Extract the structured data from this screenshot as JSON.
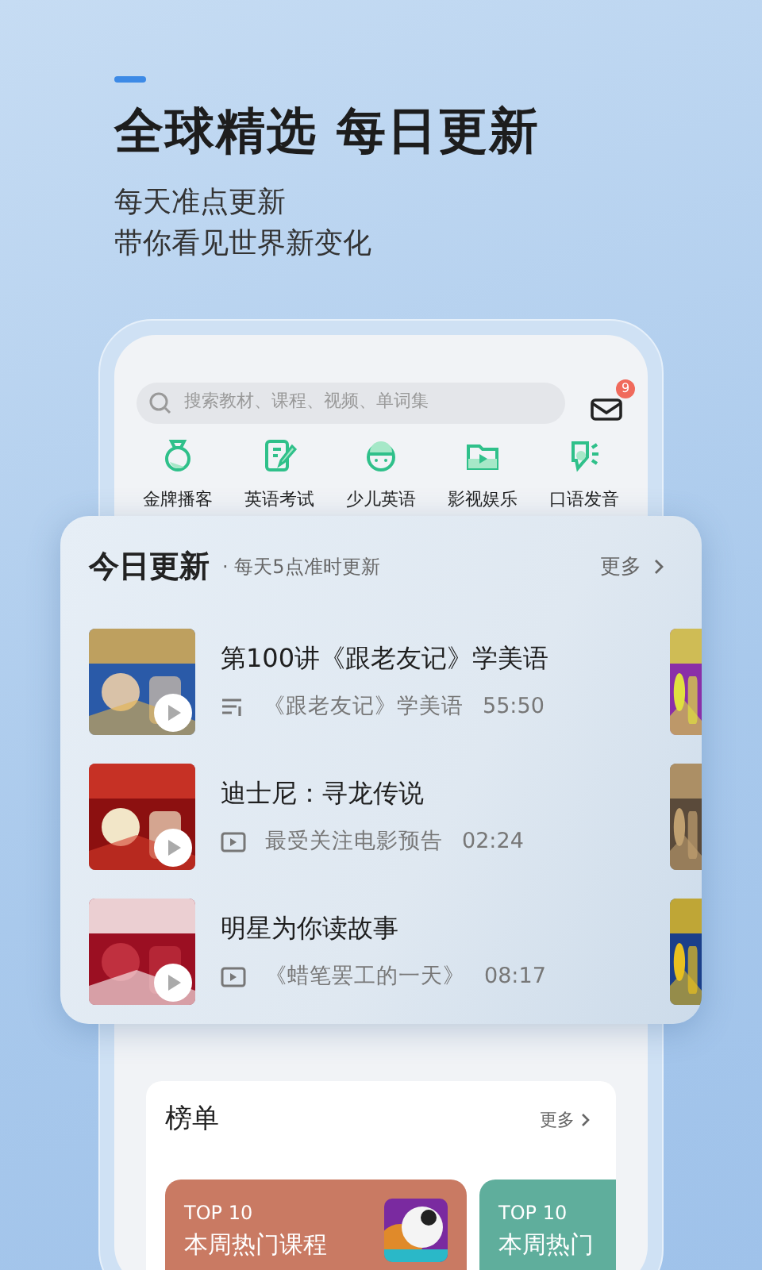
{
  "headline": "全球精选 每日更新",
  "subtitle_lines": [
    "每天准点更新",
    "带你看见世界新变化"
  ],
  "search": {
    "placeholder": "搜索教材、课程、视频、单词集"
  },
  "mail_badge": "9",
  "categories": [
    {
      "label": "金牌播客"
    },
    {
      "label": "英语考试"
    },
    {
      "label": "少儿英语"
    },
    {
      "label": "影视娱乐"
    },
    {
      "label": "口语发音"
    }
  ],
  "today": {
    "title": "今日更新",
    "subtitle": "· 每天5点准时更新",
    "more": "更多",
    "items": [
      {
        "title": "第100讲《跟老友记》学美语",
        "kind": "audio",
        "source": "《跟老友记》学美语",
        "duration": "55:50"
      },
      {
        "title": "迪士尼：寻龙传说",
        "kind": "video",
        "source": "最受关注电影预告",
        "duration": "02:24"
      },
      {
        "title": "明星为你读故事",
        "kind": "video",
        "source": "《蜡笔罢工的一天》",
        "duration": "08:17"
      }
    ]
  },
  "ranking": {
    "title": "榜单",
    "more": "更多",
    "cards": [
      {
        "tag": "TOP 10",
        "title": "本周热门课程",
        "color": "#c97a63"
      },
      {
        "tag": "TOP 10",
        "title": "本周热门",
        "color": "#5fae9c"
      }
    ]
  }
}
